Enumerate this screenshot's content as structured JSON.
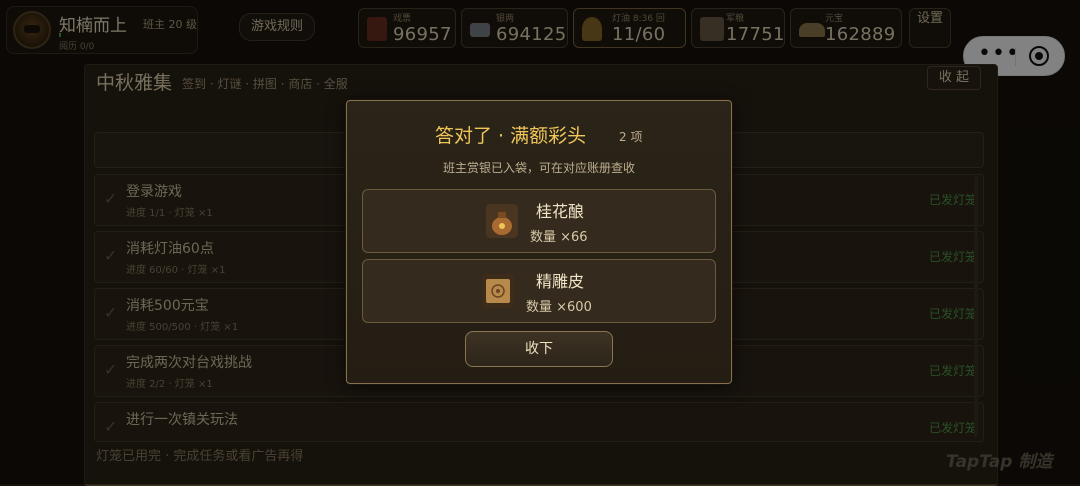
{
  "profile": {
    "name": "知楠而上",
    "level": "班主 20 级",
    "stat": "阅历 0/0"
  },
  "rules_button": "游戏规则",
  "resources": [
    {
      "label": "戏票",
      "value": "96957",
      "icon": "ticket-icon"
    },
    {
      "label": "银两",
      "value": "694125",
      "icon": "silver-icon"
    },
    {
      "label": "灯油 8:36 回",
      "value": "11/60",
      "icon": "oil-lamp-icon"
    },
    {
      "label": "军粮",
      "value": "17751",
      "icon": "grain-icon"
    },
    {
      "label": "元宝",
      "value": "162889",
      "icon": "gold-ingot-icon"
    }
  ],
  "settings_label": "设置",
  "capsule": {
    "more": "•••"
  },
  "panel": {
    "title": "中秋雅集",
    "subtitle": "签到 · 灯谜 · 拼图 · 商店 · 全服",
    "collapse_label": "收 起",
    "tasks": [
      {
        "name": "登录游戏",
        "progress": "进度 1/1 · 灯笼 ×1",
        "status": "已发灯笼"
      },
      {
        "name": "消耗灯油60点",
        "progress": "进度 60/60 · 灯笼 ×1",
        "status": "已发灯笼"
      },
      {
        "name": "消耗500元宝",
        "progress": "进度 500/500 · 灯笼 ×1",
        "status": "已发灯笼"
      },
      {
        "name": "完成两次对台戏挑战",
        "progress": "进度 2/2 · 灯笼 ×1",
        "status": "已发灯笼"
      },
      {
        "name": "进行一次镇关玩法",
        "progress": "",
        "status": "已发灯笼"
      }
    ],
    "footer": "灯笼已用完 · 完成任务或看广告再得"
  },
  "watermark": "TapTap 制造",
  "modal": {
    "title": "答对了 · 满额彩头",
    "count": "2 项",
    "subtitle": "班主赏银已入袋，可在对应账册查收",
    "rewards": [
      {
        "name": "桂花酿",
        "quantity": "数量 ×66",
        "icon": "osmanthus-wine-icon"
      },
      {
        "name": "精雕皮",
        "quantity": "数量 ×600",
        "icon": "carved-leather-icon"
      }
    ],
    "collect_label": "收下"
  },
  "colors": {
    "gold_title": "#f0c55a",
    "status_green": "#4f9a48",
    "modal_border": "#86714c"
  }
}
